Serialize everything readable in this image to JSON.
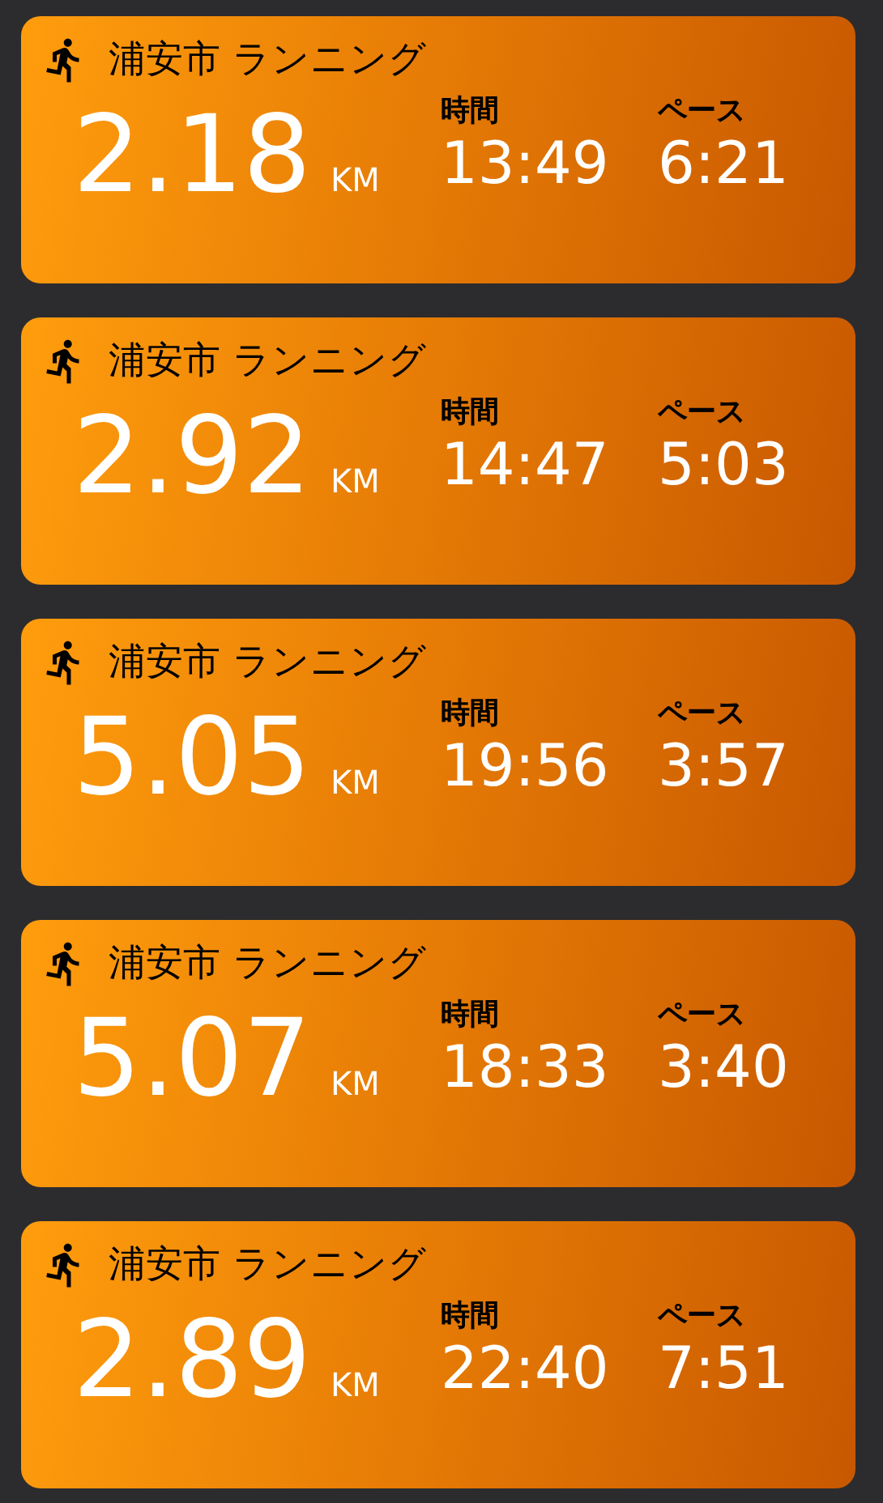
{
  "workouts": [
    {
      "title": "浦安市 ランニング",
      "distance": "2.18",
      "unit": "KM",
      "time_label": "時間",
      "time": "13:49",
      "pace_label": "ペース",
      "pace": "6:21"
    },
    {
      "title": "浦安市 ランニング",
      "distance": "2.92",
      "unit": "KM",
      "time_label": "時間",
      "time": "14:47",
      "pace_label": "ペース",
      "pace": "5:03"
    },
    {
      "title": "浦安市 ランニング",
      "distance": "5.05",
      "unit": "KM",
      "time_label": "時間",
      "time": "19:56",
      "pace_label": "ペース",
      "pace": "3:57"
    },
    {
      "title": "浦安市 ランニング",
      "distance": "5.07",
      "unit": "KM",
      "time_label": "時間",
      "time": "18:33",
      "pace_label": "ペース",
      "pace": "3:40"
    },
    {
      "title": "浦安市 ランニング",
      "distance": "2.89",
      "unit": "KM",
      "time_label": "時間",
      "time": "22:40",
      "pace_label": "ペース",
      "pace": "7:51"
    }
  ]
}
